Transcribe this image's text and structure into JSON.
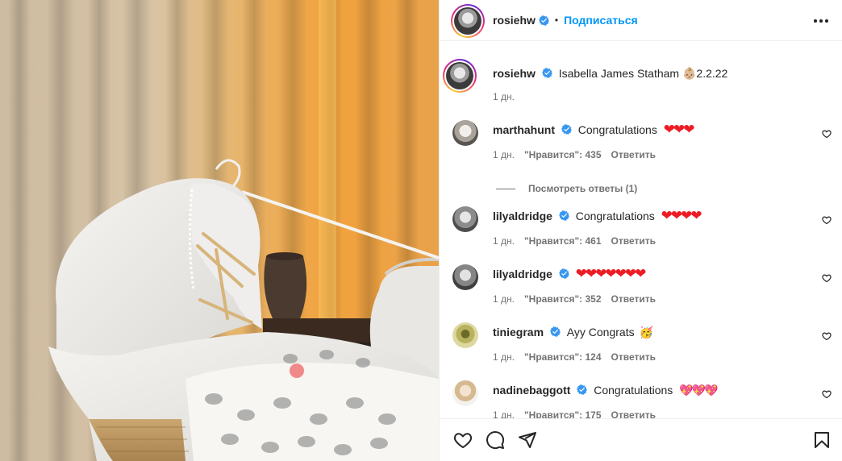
{
  "header": {
    "username": "rosiehw",
    "separator": "•",
    "follow_label": "Подписаться",
    "more_icon": "more-horizontal-icon"
  },
  "caption": {
    "username": "rosiehw",
    "text": "Isabella James Statham 👶🏼2.2.22",
    "time": "1 дн."
  },
  "comments": [
    {
      "username": "marthahunt",
      "text": "Congratulations",
      "emoji": "❤❤❤",
      "emoji_style": "red",
      "time": "1 дн.",
      "likes": "\"Нравится\": 435",
      "reply": "Ответить",
      "avatar_tone": "#d9d6d2"
    },
    {
      "username": "lilyaldridge",
      "text": "Congratulations",
      "emoji": "❤❤❤❤",
      "emoji_style": "red",
      "time": "1 дн.",
      "likes": "\"Нравится\": 461",
      "reply": "Ответить",
      "avatar_tone": "#bdbdbd"
    },
    {
      "username": "lilyaldridge",
      "text": "",
      "emoji": "❤❤❤❤❤❤❤",
      "emoji_style": "red",
      "time": "1 дн.",
      "likes": "\"Нравится\": 352",
      "reply": "Ответить",
      "avatar_tone": "#b0b0b0"
    },
    {
      "username": "tiniegram",
      "text": "Ayy Congrats",
      "emoji": "🥳",
      "emoji_style": "plain",
      "time": "1 дн.",
      "likes": "\"Нравится\": 124",
      "reply": "Ответить",
      "avatar_tone": "#c6c18a"
    },
    {
      "username": "nadinebaggott",
      "text": "Congratulations",
      "emoji": "💖💖💖",
      "emoji_style": "pink",
      "time": "1 дн.",
      "likes": "\"Нравится\": 175",
      "reply": "Ответить",
      "avatar_tone": "#e3cdb0"
    }
  ],
  "view_replies": "Посмотреть ответы (1)",
  "actions": {
    "like_icon": "heart-icon",
    "comment_icon": "comment-icon",
    "share_icon": "share-icon",
    "save_icon": "bookmark-icon"
  },
  "colors": {
    "link_blue": "#0095f6",
    "verified_blue": "#3897f0",
    "secondary_text": "#737373",
    "divider": "#efefef"
  }
}
